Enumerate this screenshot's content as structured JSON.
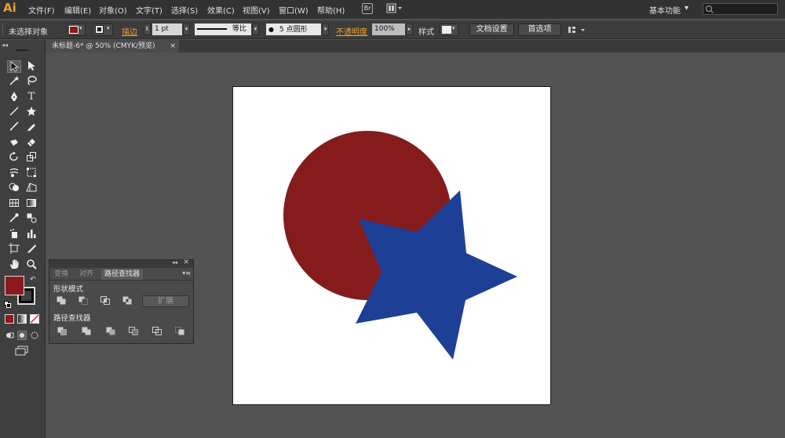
{
  "app": {
    "logo": "Ai"
  },
  "menu": [
    "文件(F)",
    "编辑(E)",
    "对象(O)",
    "文字(T)",
    "选择(S)",
    "效果(C)",
    "视图(V)",
    "窗口(W)",
    "帮助(H)"
  ],
  "bridge_labels": [
    "Br",
    "St"
  ],
  "workspace": {
    "label": "基本功能",
    "arrow": "▾"
  },
  "control": {
    "selection_status": "未选择对象",
    "stroke_label": "描边",
    "stroke_weight": "1 pt",
    "stroke_style": "等比",
    "brush": "5 点圆形",
    "opacity_label": "不透明度",
    "opacity": "100%",
    "style_label": "样式",
    "doc_setup": "文档设置",
    "preferences": "首选项",
    "fill_color": "#8b1a1e"
  },
  "document": {
    "tab_title": "未标题-6* @ 50% (CMYK/预览)",
    "close": "×"
  },
  "tools": {
    "fill_color": "#8b1a1e",
    "stroke_color": "#000000"
  },
  "artwork": {
    "circle_color": "#861b1e",
    "star_color": "#1e3f96"
  },
  "pathfinder": {
    "tabs": [
      "变换",
      "对齐",
      "路径查找器"
    ],
    "shape_modes_label": "形状模式",
    "pathfinders_label": "路径查找器",
    "expand_button": "扩展"
  }
}
